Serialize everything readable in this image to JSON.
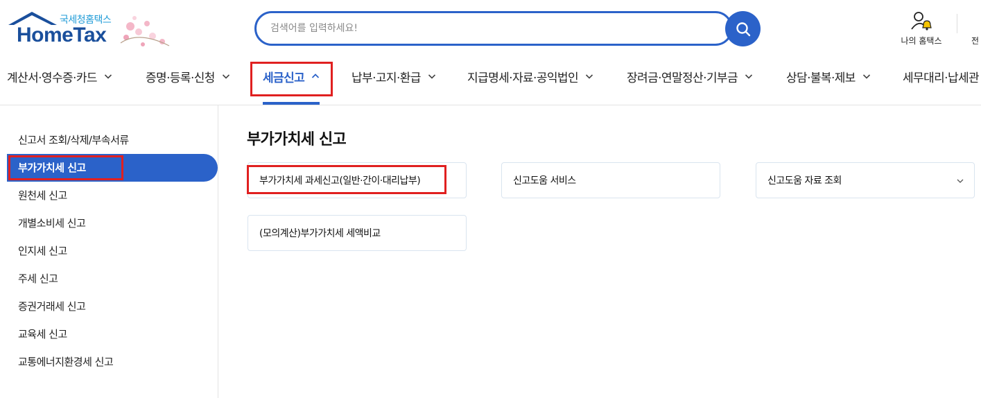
{
  "brand": {
    "subtitle": "국세청홈택스",
    "name": "HomeTax",
    "color": "#1a4f9c",
    "accent": "#1e9bd7"
  },
  "search": {
    "placeholder": "검색어를 입력하세요!",
    "value": "",
    "icon": "search-icon",
    "color": "#2b62c9"
  },
  "header_links": {
    "my_hometax": "나의 홈택스",
    "my_hometax_icon": "user-bell-icon",
    "cut_label": "전"
  },
  "nav": {
    "items": [
      {
        "label": "계산서·영수증·카드",
        "icon": "chevron-down-icon"
      },
      {
        "label": "증명·등록·신청",
        "icon": "chevron-down-icon"
      },
      {
        "label": "세금신고",
        "icon": "chevron-up-icon",
        "active": true
      },
      {
        "label": "납부·고지·환급",
        "icon": "chevron-down-icon"
      },
      {
        "label": "지급명세·자료·공익법인",
        "icon": "chevron-down-icon"
      },
      {
        "label": "장려금·연말정산·기부금",
        "icon": "chevron-down-icon"
      },
      {
        "label": "상담·불복·제보",
        "icon": "chevron-down-icon"
      },
      {
        "label": "세무대리·납세관"
      }
    ]
  },
  "sidebar": {
    "items": [
      {
        "label": "신고서 조회/삭제/부속서류"
      },
      {
        "label": "부가가치세 신고",
        "active": true
      },
      {
        "label": "원천세 신고"
      },
      {
        "label": "개별소비세 신고"
      },
      {
        "label": "인지세 신고"
      },
      {
        "label": "주세 신고"
      },
      {
        "label": "증권거래세 신고"
      },
      {
        "label": "교육세 신고"
      },
      {
        "label": "교통에너지환경세 신고"
      }
    ]
  },
  "main": {
    "title": "부가가치세 신고",
    "cards": [
      {
        "label": "부가가치세 과세신고(일반·간이·대리납부)"
      },
      {
        "label": "신고도움 서비스"
      },
      {
        "label": "신고도움 자료 조회",
        "icon": "chevron-down-icon"
      },
      {
        "label": "(모의계산)부가가치세 세액비교"
      }
    ]
  },
  "colors": {
    "primary": "#2b62c9",
    "highlight": "#e02020",
    "card_border": "#d9e4ef"
  }
}
